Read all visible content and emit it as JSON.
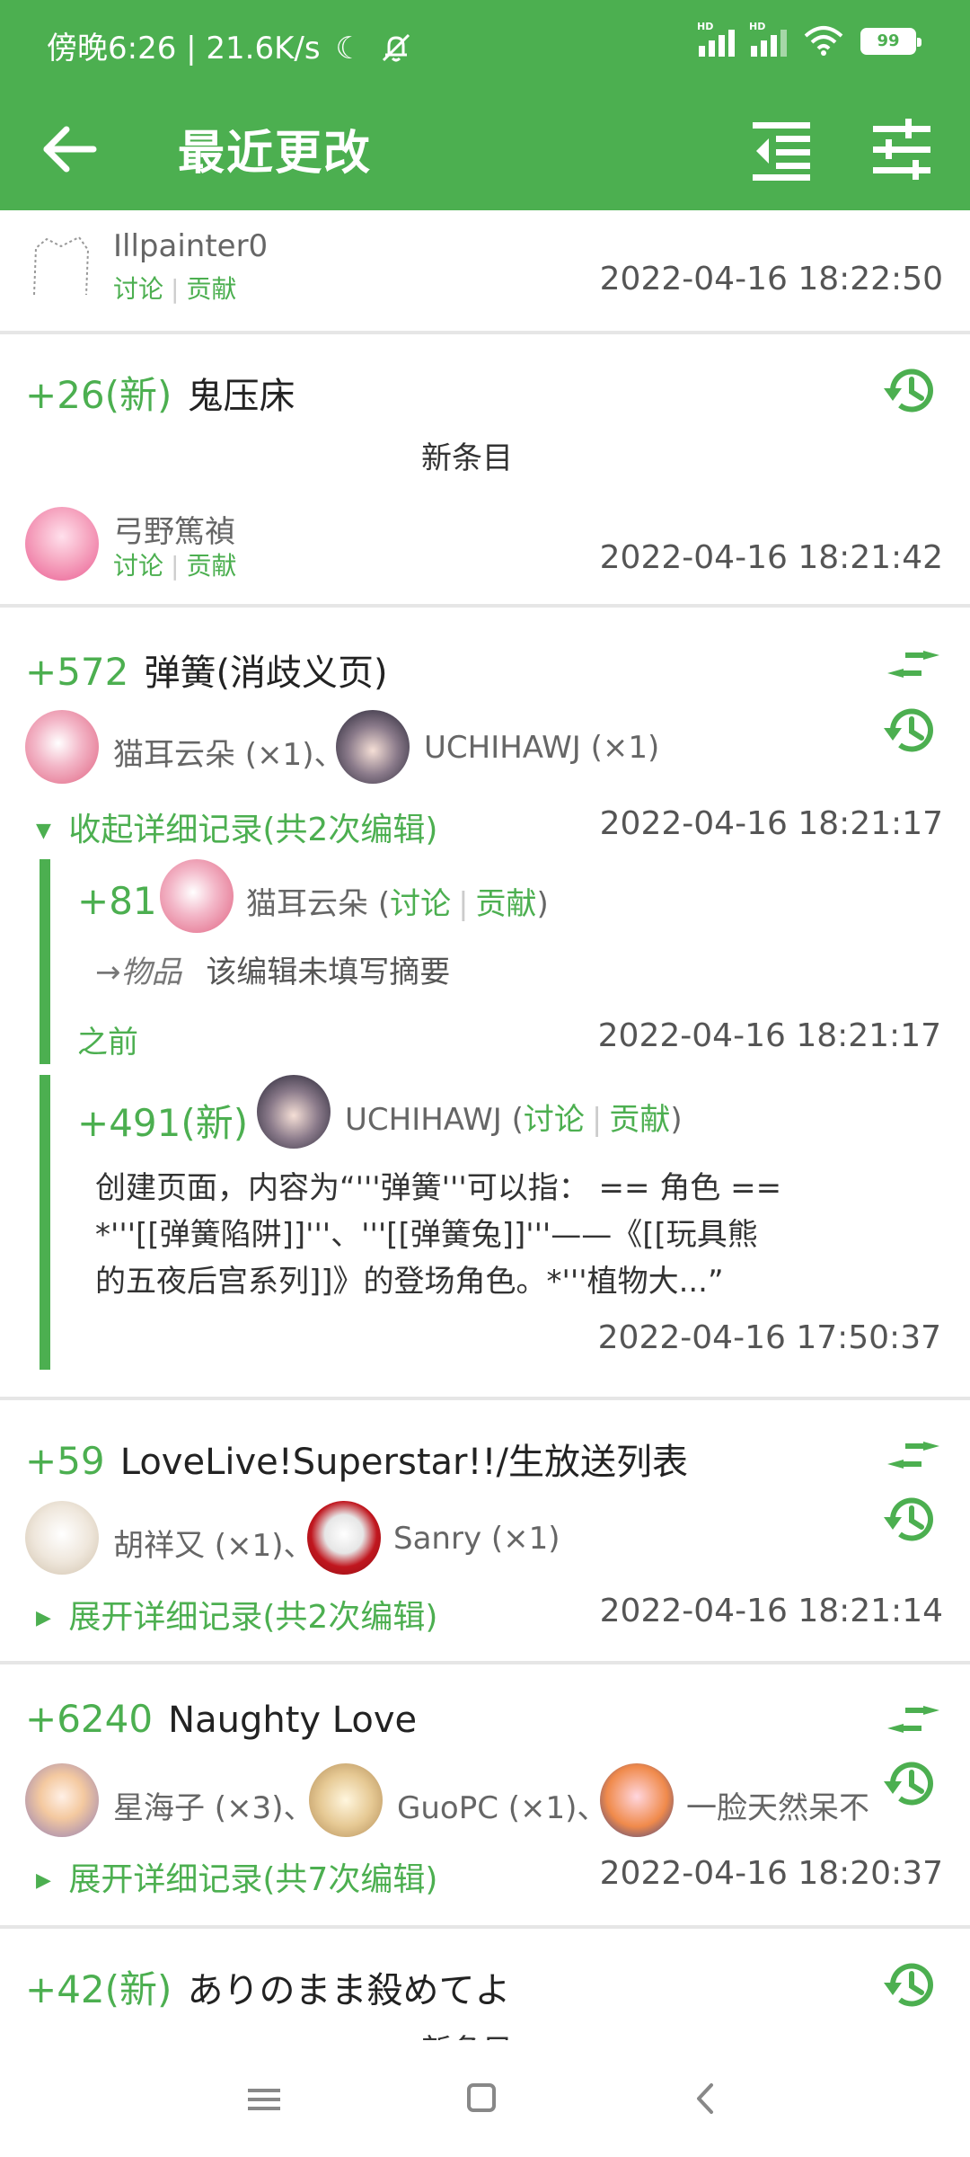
{
  "status_bar": {
    "text": "傍晚6:26 | 21.6K/s",
    "battery": "99",
    "hd1": "HD",
    "hd2": "HD"
  },
  "app_bar": {
    "title": "最近更改"
  },
  "entries": [
    {
      "user": "Illpainter0",
      "talk": "讨论",
      "contrib": "贡献",
      "time": "2022-04-16 18:22:50"
    },
    {
      "delta": "+26(新)",
      "title": "鬼压床",
      "summary": "新条目",
      "user": "弓野篤禎",
      "talk": "讨论",
      "contrib": "贡献",
      "time": "2022-04-16 18:21:42"
    },
    {
      "delta": "+572",
      "title": "弹簧(消歧义页)",
      "users": [
        {
          "name": "猫耳云朵 (×1)、"
        },
        {
          "name": "UCHIHAWJ (×1)"
        }
      ],
      "toggle": "收起详细记录(共2次编辑)",
      "time": "2022-04-16 18:21:17",
      "subs": [
        {
          "delta": "+81",
          "user": "猫耳云朵",
          "talk": "讨论",
          "contrib": "贡献",
          "paren_open": "(",
          "paren_close": ")",
          "section": "→物品",
          "summary": "该编辑未填写摘要",
          "prev": "之前",
          "time": "2022-04-16 18:21:17"
        },
        {
          "delta": "+491(新)",
          "user": "UCHIHAWJ",
          "talk": "讨论",
          "contrib": "贡献",
          "paren_open": "(",
          "paren_close": ")",
          "lines": [
            "创建页面，内容为“'''弹簧'''可以指：  == 角色 ==",
            "*'''[[弹簧陷阱]]'''、'''[[弹簧兔]]'''——《[[玩具熊",
            "的五夜后宫系列]]》的登场角色。*'''植物大...”"
          ],
          "time": "2022-04-16 17:50:37"
        }
      ]
    },
    {
      "delta": "+59",
      "title": "LoveLive!Superstar!!/生放送列表",
      "users": [
        {
          "name": "胡祥又 (×1)、"
        },
        {
          "name": "Sanry (×1)"
        }
      ],
      "toggle": "展开详细记录(共2次编辑)",
      "time": "2022-04-16 18:21:14"
    },
    {
      "delta": "+6240",
      "title": "Naughty Love",
      "users": [
        {
          "name": "星海子 (×3)、"
        },
        {
          "name": "GuoPC (×1)、"
        },
        {
          "name": "一脸天然呆不"
        }
      ],
      "toggle": "展开详细记录(共7次编辑)",
      "time": "2022-04-16 18:20:37"
    },
    {
      "delta": "+42(新)",
      "title": "ありのまま殺めてよ",
      "summary": "新条目"
    }
  ]
}
